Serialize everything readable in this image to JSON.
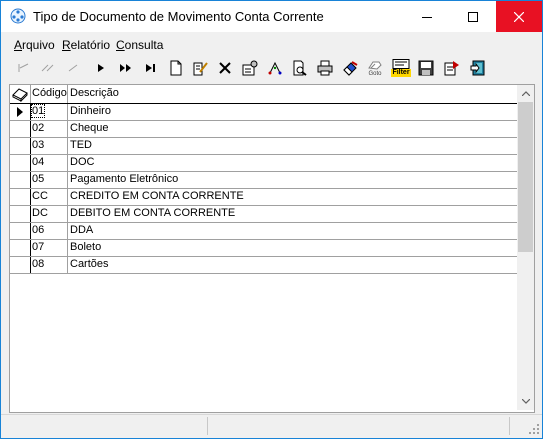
{
  "window": {
    "title": "Tipo de Documento de Movimento Conta Corrente",
    "icon": "app-icon",
    "controls": [
      "minimize-icon",
      "maximize-icon",
      "close-icon"
    ]
  },
  "menu": {
    "items": [
      {
        "label": "Arquivo",
        "accel_char": "A"
      },
      {
        "label": "Relatório",
        "accel_char": "R"
      },
      {
        "label": "Consulta",
        "accel_char": "C"
      }
    ]
  },
  "toolbar": {
    "buttons": [
      {
        "icon": "first-record-icon",
        "enabled": false
      },
      {
        "icon": "prior-page-icon",
        "enabled": false
      },
      {
        "icon": "prior-record-icon",
        "enabled": false
      },
      {
        "icon": "next-record-icon",
        "enabled": true
      },
      {
        "icon": "next-page-icon",
        "enabled": true
      },
      {
        "icon": "last-record-icon",
        "enabled": true
      },
      {
        "icon": "new-document-icon",
        "enabled": true
      },
      {
        "icon": "edit-document-icon",
        "enabled": true
      },
      {
        "icon": "delete-icon",
        "enabled": true
      },
      {
        "icon": "properties-icon",
        "enabled": true
      },
      {
        "icon": "sort-icon",
        "enabled": true
      },
      {
        "icon": "search-document-icon",
        "enabled": true
      },
      {
        "icon": "print-icon",
        "enabled": true
      },
      {
        "icon": "eraser-icon",
        "enabled": true
      },
      {
        "icon": "goto-icon",
        "label": "Goto",
        "enabled": true
      },
      {
        "icon": "filter-icon",
        "label": "Filter",
        "enabled": true
      },
      {
        "icon": "save-icon",
        "enabled": true
      },
      {
        "icon": "export-icon",
        "enabled": true
      },
      {
        "icon": "exit-icon",
        "enabled": true
      }
    ]
  },
  "grid": {
    "columns": [
      "Código",
      "Descrição"
    ],
    "rows": [
      {
        "codigo": "01",
        "descricao": "Dinheiro"
      },
      {
        "codigo": "02",
        "descricao": "Cheque"
      },
      {
        "codigo": "03",
        "descricao": "TED"
      },
      {
        "codigo": "04",
        "descricao": "DOC"
      },
      {
        "codigo": "05",
        "descricao": "Pagamento Eletrônico"
      },
      {
        "codigo": "CC",
        "descricao": "CREDITO EM CONTA CORRENTE"
      },
      {
        "codigo": "DC",
        "descricao": "DEBITO EM CONTA CORRENTE"
      },
      {
        "codigo": "06",
        "descricao": "DDA"
      },
      {
        "codigo": "07",
        "descricao": "Boleto"
      },
      {
        "codigo": "08",
        "descricao": "Cartões"
      }
    ],
    "current_row": 0
  },
  "colors": {
    "window_border": "#1883d7",
    "close_hover": "#e81123",
    "filter_bg": "#ffd700"
  }
}
